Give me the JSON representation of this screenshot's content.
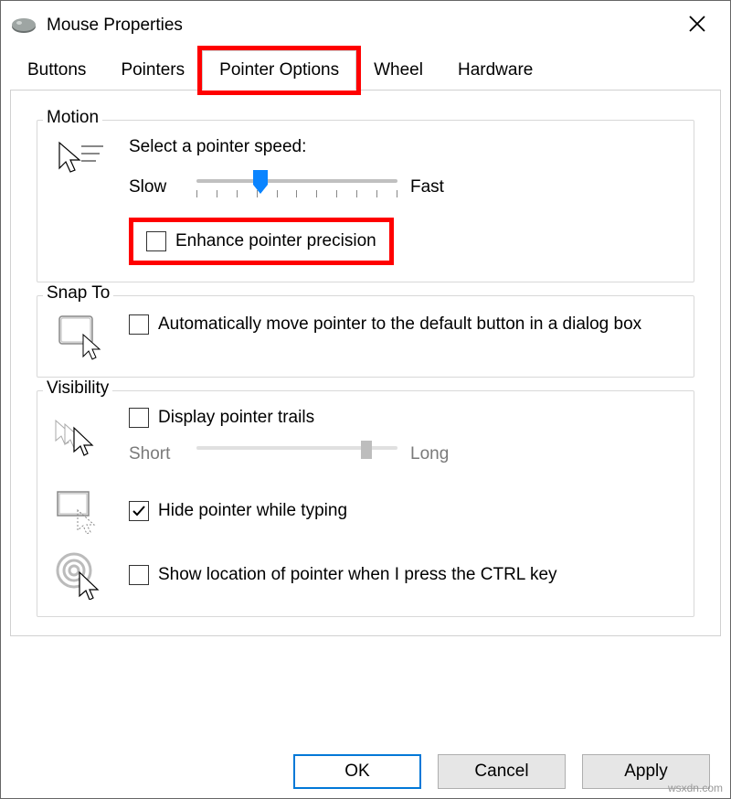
{
  "title": "Mouse Properties",
  "tabs": [
    "Buttons",
    "Pointers",
    "Pointer Options",
    "Wheel",
    "Hardware"
  ],
  "active_tab": 2,
  "motion": {
    "group_label": "Motion",
    "speed_label": "Select a pointer speed:",
    "slow": "Slow",
    "fast": "Fast",
    "speed_value": 4,
    "speed_max": 10,
    "enhance_label": "Enhance pointer precision",
    "enhance_checked": false
  },
  "snap": {
    "group_label": "Snap To",
    "auto_label": "Automatically move pointer to the default button in a dialog box",
    "auto_checked": false
  },
  "visibility": {
    "group_label": "Visibility",
    "trails_label": "Display pointer trails",
    "trails_checked": false,
    "trails_short": "Short",
    "trails_long": "Long",
    "hide_label": "Hide pointer while typing",
    "hide_checked": true,
    "ctrl_label": "Show location of pointer when I press the CTRL key",
    "ctrl_checked": false
  },
  "buttons": {
    "ok": "OK",
    "cancel": "Cancel",
    "apply": "Apply"
  },
  "watermark": "wsxdn.com"
}
